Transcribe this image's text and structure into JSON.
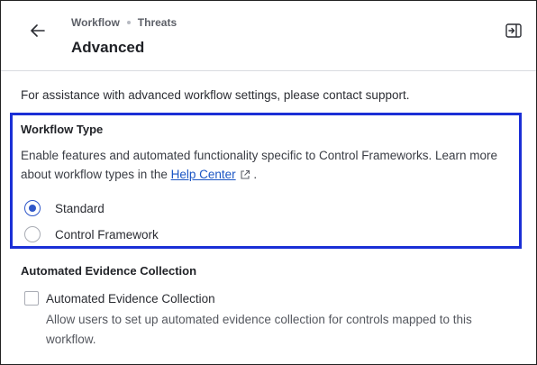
{
  "header": {
    "breadcrumb": [
      "Workflow",
      "Threats"
    ],
    "title": "Advanced"
  },
  "intro_text": "For assistance with advanced workflow settings, please contact support.",
  "workflow_type": {
    "title": "Workflow Type",
    "description_pre": "Enable features and automated functionality specific to Control Frameworks. Learn more about workflow types in the",
    "help_link": "Help Center",
    "description_post": ".",
    "options": [
      {
        "label": "Standard",
        "selected": true
      },
      {
        "label": "Control Framework",
        "selected": false
      }
    ]
  },
  "evidence": {
    "title": "Automated Evidence Collection",
    "checkbox_label": "Automated Evidence Collection",
    "checked": false,
    "description": "Allow users to set up automated evidence collection for controls mapped to this workflow."
  },
  "colors": {
    "accent": "#2f57c9",
    "focus_border": "#1b2fd6",
    "link": "#1a55c4"
  },
  "icons": {
    "back": "arrow-left-icon",
    "collapse": "panel-collapse-icon",
    "external": "external-link-icon"
  }
}
